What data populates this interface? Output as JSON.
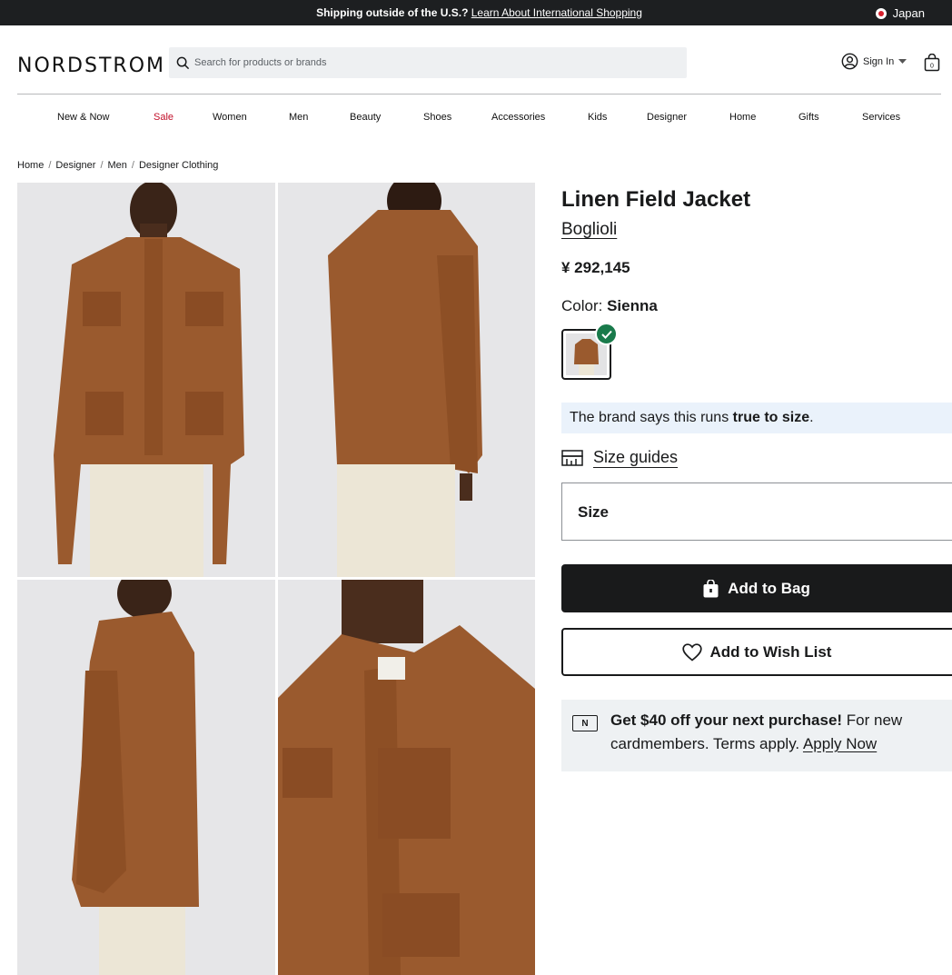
{
  "banner": {
    "message": "Shipping outside of the U.S.?",
    "link": "Learn About International Shopping",
    "country": "Japan"
  },
  "header": {
    "logo": "NORDSTROM",
    "search_placeholder": "Search for products or brands",
    "sign_in": "Sign In"
  },
  "nav": [
    {
      "label": "New & Now"
    },
    {
      "label": "Sale"
    },
    {
      "label": "Women"
    },
    {
      "label": "Men"
    },
    {
      "label": "Beauty"
    },
    {
      "label": "Shoes"
    },
    {
      "label": "Accessories"
    },
    {
      "label": "Kids"
    },
    {
      "label": "Designer"
    },
    {
      "label": "Home"
    },
    {
      "label": "Gifts"
    },
    {
      "label": "Services"
    }
  ],
  "breadcrumb": [
    "Home",
    "Designer",
    "Men",
    "Designer Clothing"
  ],
  "product": {
    "title": "Linen Field Jacket",
    "brand": "Boglioli",
    "price": "¥ 292,145",
    "color_label": "Color:",
    "color_value": "Sienna",
    "fit_prefix": "The brand says this runs ",
    "fit_value": "true to size",
    "fit_suffix": ".",
    "size_guides": "Size guides",
    "size_label": "Size",
    "add_to_bag": "Add to Bag",
    "add_to_wish": "Add to Wish List"
  },
  "promo": {
    "card_letter": "N",
    "headline": "Get $40 off your next purchase!",
    "body": " For new cardmembers. Terms apply. ",
    "link": "Apply Now"
  },
  "colors": {
    "jacket": "#9a5a2e",
    "check": "#197a4b",
    "sale": "#c2102a"
  }
}
